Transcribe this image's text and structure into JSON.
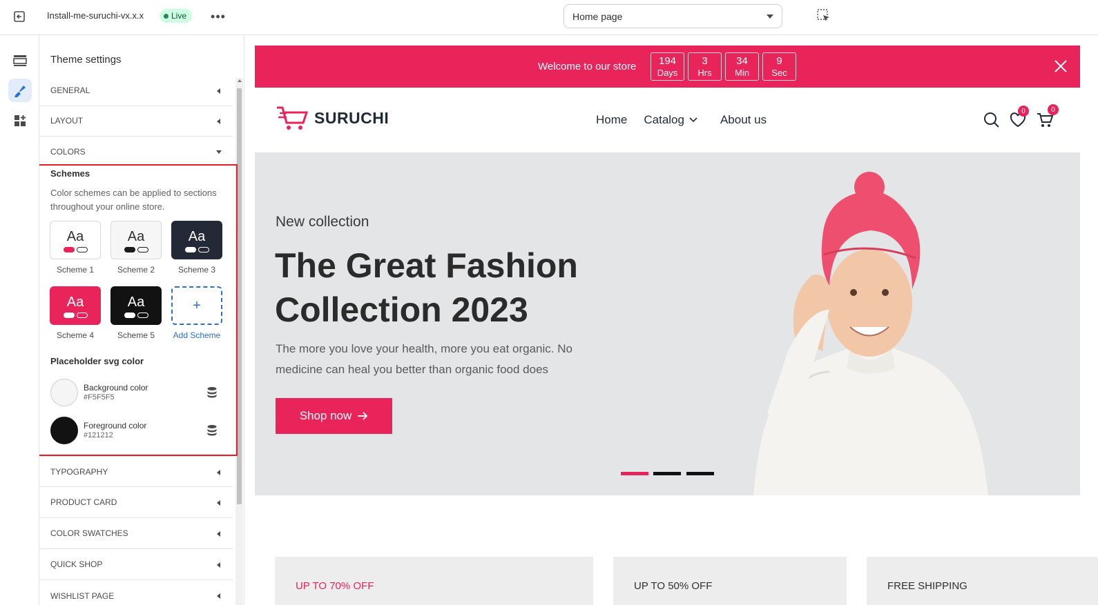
{
  "topbar": {
    "theme_name": "Install-me-suruchi-vx.x.x",
    "live_label": "Live",
    "page_select": "Home page"
  },
  "panel": {
    "title": "Theme settings",
    "sections_top": [
      "GENERAL",
      "LAYOUT",
      "COLORS"
    ],
    "schemes_label": "Schemes",
    "schemes_desc": "Color schemes can be applied to sections throughout your online store.",
    "schemes": [
      {
        "name": "Scheme 1",
        "bg": "#ffffff",
        "fg": "#303030",
        "p1": "#e8245a",
        "p2": "#303030"
      },
      {
        "name": "Scheme 2",
        "bg": "#f6f6f7",
        "fg": "#303030",
        "p1": "#1a1a1a",
        "p2": "#1a1a1a"
      },
      {
        "name": "Scheme 3",
        "bg": "#232936",
        "fg": "#ffffff",
        "p1": "#ffffff",
        "p2": "#ffffff"
      },
      {
        "name": "Scheme 4",
        "bg": "#e8245a",
        "fg": "#ffffff",
        "p1": "#ffffff",
        "p2": "#ffffff"
      },
      {
        "name": "Scheme 5",
        "bg": "#121212",
        "fg": "#ffffff",
        "p1": "#ffffff",
        "p2": "#ffffff"
      }
    ],
    "add_scheme": {
      "icon": "+",
      "label": "Add Scheme"
    },
    "placeholder_label": "Placeholder svg color",
    "bg_color": {
      "label": "Background color",
      "hex": "#F5F5F5"
    },
    "fg_color": {
      "label": "Foreground color",
      "hex": "#121212"
    },
    "sections_bottom": [
      "TYPOGRAPHY",
      "PRODUCT CARD",
      "COLOR SWATCHES",
      "QUICK SHOP",
      "WISHLIST PAGE"
    ]
  },
  "preview": {
    "announcement": "Welcome to our store",
    "countdown": [
      {
        "num": "194",
        "unit": "Days"
      },
      {
        "num": "3",
        "unit": "Hrs"
      },
      {
        "num": "34",
        "unit": "Min"
      },
      {
        "num": "9",
        "unit": "Sec"
      }
    ],
    "logo": "SURUCHI",
    "nav": [
      "Home",
      "Catalog",
      "About us"
    ],
    "wishlist_count": "0",
    "cart_count": "0",
    "hero": {
      "subtitle": "New collection",
      "headline": "The Great Fashion Collection 2023",
      "desc": "The more you love your health, more you eat organic. No medicine can heal you better than organic food does",
      "button": "Shop now"
    },
    "promos": [
      "UP TO 70% OFF",
      "UP TO 50% OFF",
      "FREE SHIPPING"
    ]
  },
  "colors": {
    "accent": "#e8245a",
    "highlight": "#e11d2a",
    "link": "#2c6ecb"
  }
}
